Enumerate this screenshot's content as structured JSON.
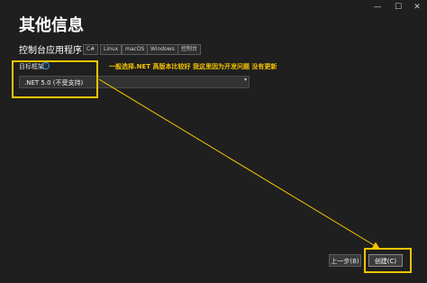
{
  "window": {
    "minimize": "—",
    "maximize": "☐",
    "close": "✕"
  },
  "page": {
    "title": "其他信息",
    "subtitle": "控制台应用程序",
    "tags": [
      "C#",
      "Linux",
      "macOS",
      "Windows",
      "控制台"
    ]
  },
  "framework": {
    "label": "目标框架",
    "info_icon": "i",
    "selected": ".NET 5.0 (不受支持)",
    "arrow": "▾"
  },
  "annotation": {
    "text": "一般选择.NET 高版本比较好 我这里因为开发问题 没有更新",
    "color": "#f5c400"
  },
  "footer": {
    "back_label": "上一步(B)",
    "create_label": "创建(C)"
  }
}
